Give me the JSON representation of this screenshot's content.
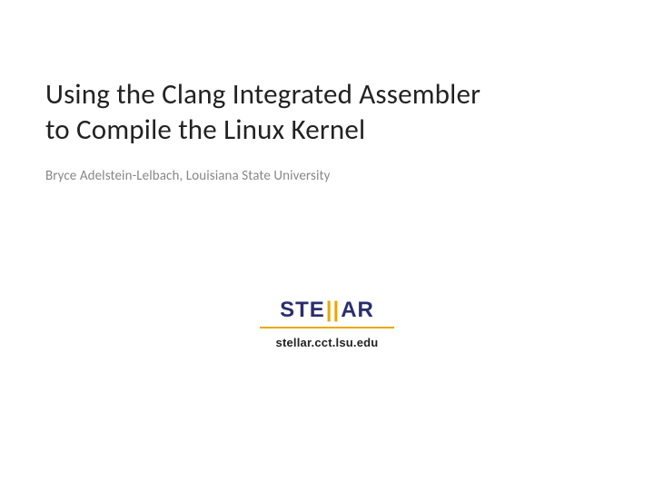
{
  "slide": {
    "title_line1": "Using the Clang Integrated Assembler",
    "title_line2": "to Compile the Linux Kernel",
    "author": "Bryce Adelstein-Lelbach, Louisiana State University"
  },
  "logo": {
    "part1": "STE",
    "pipes": "||",
    "part2": "AR",
    "url": "stellar.cct.lsu.edu"
  }
}
